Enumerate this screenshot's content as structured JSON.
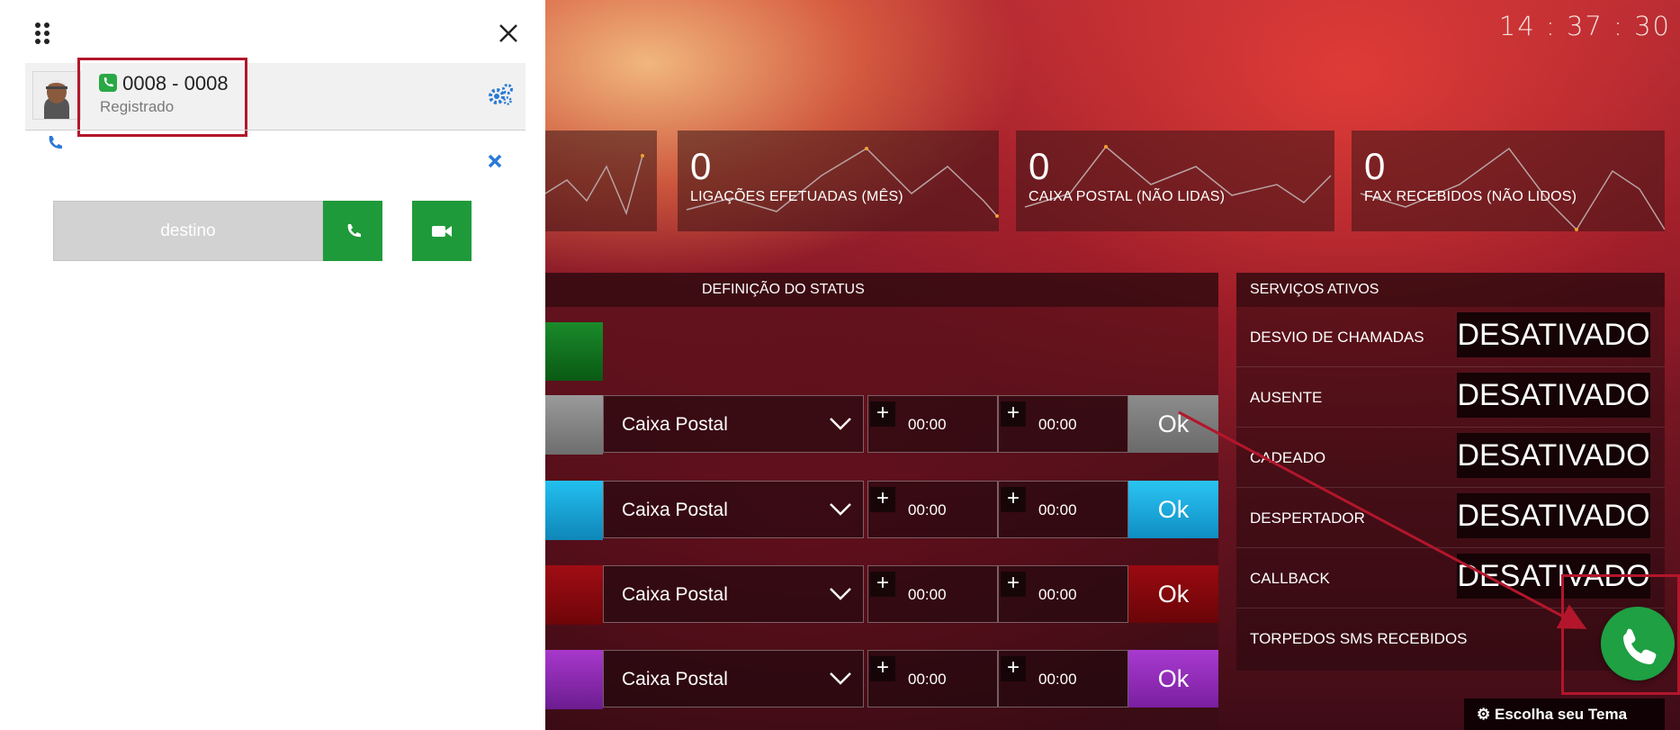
{
  "clock": "14 : 37 : 30",
  "stats": [
    {
      "value": "0",
      "label": "LIGAÇÕES EFETUADAS (MÊS)"
    },
    {
      "value": "0",
      "label": "CAIXA POSTAL (NÃO LIDAS)"
    },
    {
      "value": "0",
      "label": "FAX RECEBIDOS (NÃO LIDOS)"
    }
  ],
  "status_panel": {
    "title": "DEFINIÇÃO DO STATUS",
    "rows": [
      {
        "color": "#8a8a8a",
        "option": "Caixa Postal",
        "time1": "00:00",
        "time2": "00:00",
        "ok": "Ok",
        "plus": "+"
      },
      {
        "color": "#1aa6d8",
        "option": "Caixa Postal",
        "time1": "00:00",
        "time2": "00:00",
        "ok": "Ok",
        "plus": "+"
      },
      {
        "color": "#8f0a0f",
        "option": "Caixa Postal",
        "time1": "00:00",
        "time2": "00:00",
        "ok": "Ok",
        "plus": "+"
      },
      {
        "color": "#8a2aa8",
        "option": "Caixa Postal",
        "time1": "00:00",
        "time2": "00:00",
        "ok": "Ok",
        "plus": "+"
      }
    ],
    "top_color": "#0f6a1c"
  },
  "services": {
    "title": "SERVIÇOS ATIVOS",
    "rows": [
      {
        "label": "DESVIO DE CHAMADAS",
        "state": "DESATIVADO"
      },
      {
        "label": "AUSENTE",
        "state": "DESATIVADO"
      },
      {
        "label": "CADEADO",
        "state": "DESATIVADO"
      },
      {
        "label": "DESPERTADOR",
        "state": "DESATIVADO"
      },
      {
        "label": "CALLBACK",
        "state": "DESATIVADO"
      },
      {
        "label": "TORPEDOS SMS RECEBIDOS",
        "state": ""
      }
    ]
  },
  "theme_button": "Escolha seu Tema",
  "softphone": {
    "account": "0008 - 0008",
    "status": "Registrado",
    "destination_placeholder": "destino",
    "accent": "#2a7ad6",
    "call_green": "#1f9a3a"
  }
}
